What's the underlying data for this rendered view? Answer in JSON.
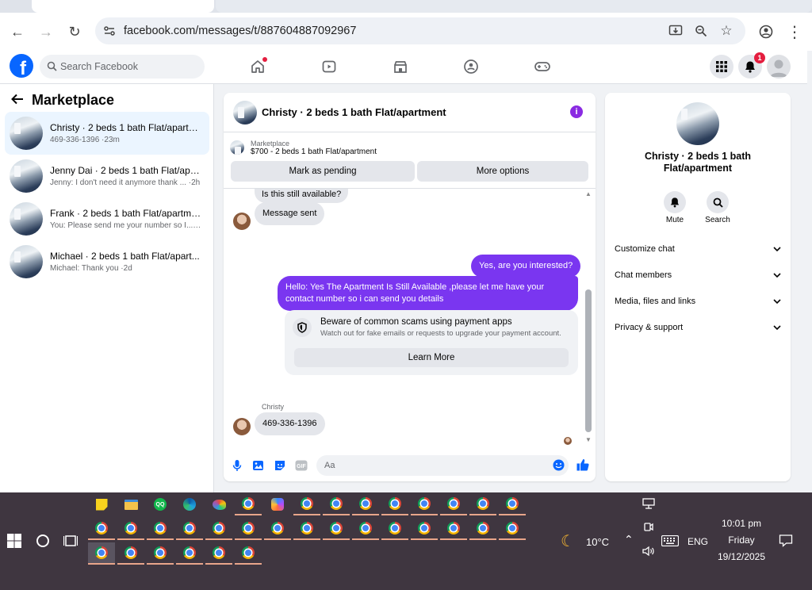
{
  "browser": {
    "url": "facebook.com/messages/t/887604887092967"
  },
  "fb": {
    "search_placeholder": "Search Facebook",
    "notif_count": "1"
  },
  "left": {
    "title": "Marketplace",
    "convs": [
      {
        "title": "Christy · 2 beds 1 bath Flat/apartm...",
        "sub": "469-336-1396 ·23m"
      },
      {
        "title": "Jenny Dai · 2 beds 1 bath Flat/apar...",
        "sub": "Jenny: I don't need it anymore thank ... ·2h"
      },
      {
        "title": "Frank · 2 beds 1 bath Flat/apartment",
        "sub": "You: Please send me your number so I... ·2h"
      },
      {
        "title": "Michael · 2 beds 1 bath Flat/apart...",
        "sub": "Michael: Thank you ·2d"
      }
    ]
  },
  "chat": {
    "title": "Christy · 2 beds 1 bath Flat/apartment",
    "mp_label": "Marketplace",
    "mp_item": "$700 - 2 beds 1 bath Flat/apartment",
    "btn_pending": "Mark as pending",
    "btn_more": "More options",
    "msgs": {
      "m1": "Is this still available?",
      "m2": "Message sent",
      "m3": "Yes, are you interested?",
      "m4": "Hello: Yes The Apartment Is Still Available ,please let me have your contact number so i can send you details",
      "warn_title": "Beware of common scams using payment apps",
      "warn_sub": "Watch out for fake emails or requests to upgrade your payment account.",
      "learn": "Learn More",
      "sender": "Christy",
      "m5": "469-336-1396"
    },
    "input_placeholder": "Aa"
  },
  "right": {
    "name": "Christy · 2 beds 1 bath Flat/apartment",
    "mute": "Mute",
    "search": "Search",
    "sections": [
      "Customize chat",
      "Chat members",
      "Media, files and links",
      "Privacy & support"
    ]
  },
  "taskbar": {
    "temp": "10°C",
    "lang": "ENG",
    "time": "10:01 pm",
    "day": "Friday",
    "date": "19/12/2025"
  }
}
